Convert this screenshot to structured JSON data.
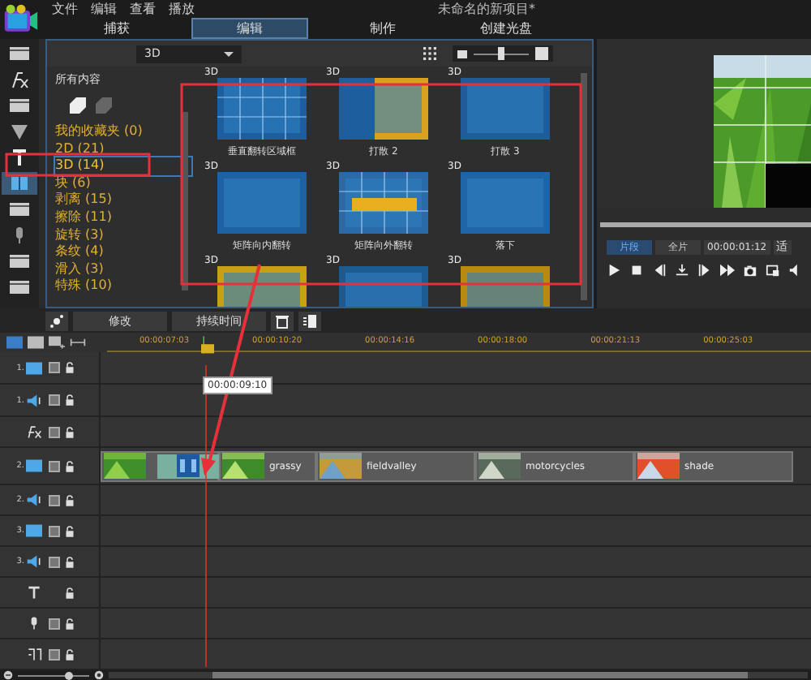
{
  "menu": [
    "文件",
    "编辑",
    "查看",
    "播放"
  ],
  "window": {
    "title": "未命名的新项目*"
  },
  "tabs": [
    {
      "label": "捕获",
      "selected": false
    },
    {
      "label": "编辑",
      "selected": true
    },
    {
      "label": "制作",
      "selected": false
    },
    {
      "label": "创建光盘",
      "selected": false
    }
  ],
  "library": {
    "dropdown": "3D",
    "size_slider": {
      "level": 0.5
    },
    "list_title": "所有内容",
    "categories": [
      {
        "label": "我的收藏夹 (0)",
        "selected": false
      },
      {
        "label": "2D (21)",
        "selected": false
      },
      {
        "label": "3D (14)",
        "selected": true
      },
      {
        "label": "块 (6)",
        "selected": false
      },
      {
        "label": "剥离 (15)",
        "selected": false
      },
      {
        "label": "擦除 (11)",
        "selected": false
      },
      {
        "label": "旋转 (3)",
        "selected": false
      },
      {
        "label": "条纹 (4)",
        "selected": false
      },
      {
        "label": "滑入 (3)",
        "selected": false
      },
      {
        "label": "特殊 (10)",
        "selected": false
      }
    ],
    "thumbnails": [
      {
        "badge": "3D",
        "label": "垂直翻转区域框"
      },
      {
        "badge": "3D",
        "label": "打散 2"
      },
      {
        "badge": "3D",
        "label": "打散 3"
      },
      {
        "badge": "3D",
        "label": "矩阵向内翻转"
      },
      {
        "badge": "3D",
        "label": "矩阵向外翻转"
      },
      {
        "badge": "3D",
        "label": "落下"
      },
      {
        "badge": "3D"
      },
      {
        "badge": "3D"
      },
      {
        "badge": "3D"
      }
    ]
  },
  "preview": {
    "modes": [
      {
        "label": "片段",
        "selected": true
      },
      {
        "label": "全片",
        "selected": false
      }
    ],
    "timecode": "00:00:01:12",
    "fit": "适"
  },
  "actions": [
    "修改",
    "持续时间"
  ],
  "ruler": [
    "00:00:07:03",
    "00:00:10:20",
    "00:00:14:16",
    "00:00:18:00",
    "00:00:21:13",
    "00:00:25:03"
  ],
  "tooltip": "00:00:09:10",
  "zoom_slider": {
    "level": 0.7
  },
  "tracks": [
    {
      "kind": "video",
      "number": "1.",
      "checked": true
    },
    {
      "kind": "audio",
      "number": "1.",
      "checked": true
    },
    {
      "kind": "fx",
      "checked": true
    },
    {
      "kind": "video",
      "number": "2.",
      "checked": true,
      "clips": [
        {
          "transition": true
        },
        {
          "name": "grassy",
          "transition": false
        },
        {
          "name": "fieldvalley",
          "transition": false
        },
        {
          "name": "motorcycles",
          "transition": false
        },
        {
          "name": "shade",
          "transition": false
        }
      ]
    },
    {
      "kind": "audio",
      "number": "2.",
      "checked": true
    },
    {
      "kind": "video",
      "number": "3.",
      "checked": true
    },
    {
      "kind": "audio",
      "number": "3.",
      "checked": true
    },
    {
      "kind": "text"
    },
    {
      "kind": "voice",
      "checked": true
    },
    {
      "kind": "music",
      "checked": true
    }
  ],
  "annotations": [
    {
      "kind": "box"
    },
    {
      "kind": "box"
    },
    {
      "kind": "arrow"
    }
  ]
}
